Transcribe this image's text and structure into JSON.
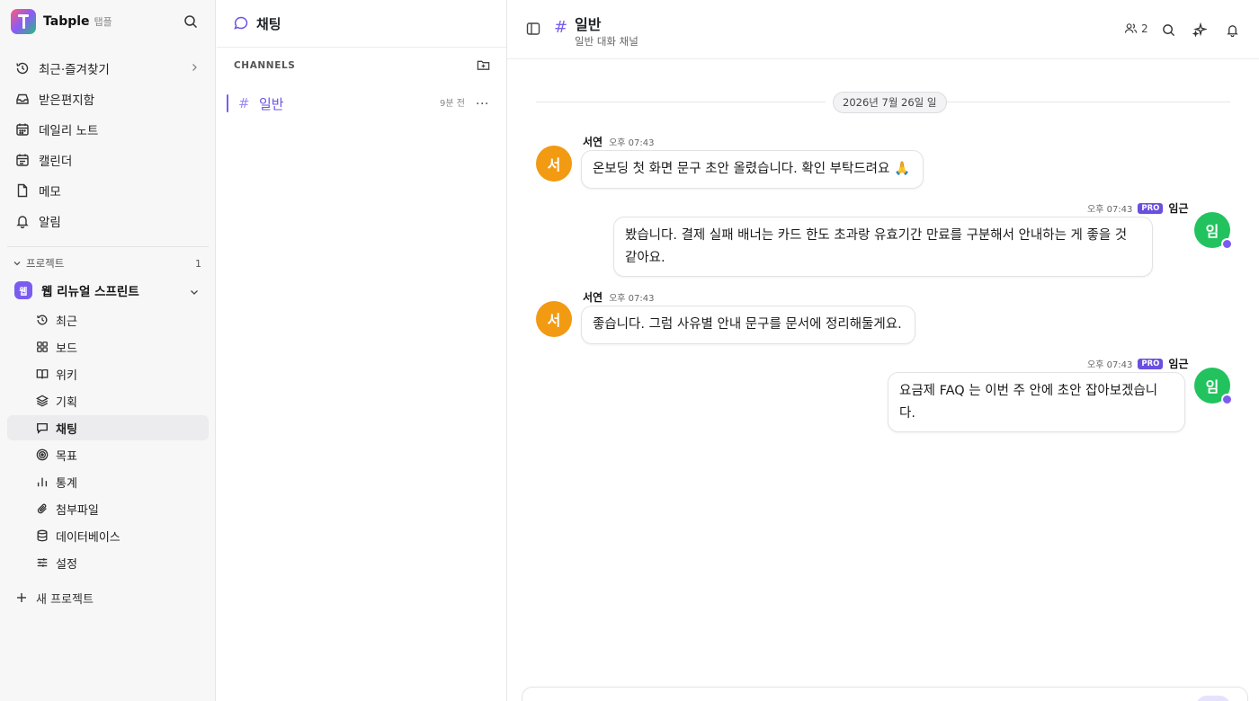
{
  "brand": {
    "name": "Tabple",
    "sub": "탭플"
  },
  "nav": {
    "recent_favorites": "최근·즐겨찾기",
    "inbox": "받은편지함",
    "daily_note": "데일리 노트",
    "calendar": "캘린더",
    "memo": "메모",
    "notifications": "알림"
  },
  "projects": {
    "header": "프로젝트",
    "count": "1",
    "current": {
      "badge": "웹",
      "name": "웹 리뉴얼 스프린트"
    },
    "items": [
      "최근",
      "보드",
      "위키",
      "기획",
      "채팅",
      "목표",
      "통계",
      "첨부파일",
      "데이터베이스",
      "설정"
    ],
    "new_label": "새 프로젝트"
  },
  "chat_panel": {
    "title": "채팅",
    "section_label": "CHANNELS",
    "channels": [
      {
        "name": "일반",
        "time": "9분 전",
        "more": "..."
      }
    ]
  },
  "chat": {
    "channel_name": "일반",
    "channel_desc": "일반 대화 채널",
    "member_count": "2",
    "date_divider": "2026년 7월 26일 일",
    "messages": [
      {
        "author": "서연",
        "avatar": "서",
        "time": "오후 07:43",
        "text": "온보딩 첫 화면 문구 초안 올렸습니다. 확인 부탁드려요 🙏"
      },
      {
        "author": "임근",
        "avatar": "임",
        "time": "오후 07:43",
        "badge": "PRO",
        "text": "봤습니다. 결제 실패 배너는 카드 한도 초과랑 유효기간 만료를 구분해서 안내하는 게 좋을 것 같아요."
      },
      {
        "author": "서연",
        "avatar": "서",
        "time": "오후 07:43",
        "text": "좋습니다. 그럼 사유별 안내 문구를 문서에 정리해둘게요."
      },
      {
        "author": "임근",
        "avatar": "임",
        "time": "오후 07:43",
        "badge": "PRO",
        "text": "요금제 FAQ 는 이번 주 안에 초안 잡아보겠습니다."
      }
    ]
  },
  "colors": {
    "accent": "#7b5cf0",
    "avatar_orange": "#f29a12",
    "avatar_green": "#22c35e"
  }
}
